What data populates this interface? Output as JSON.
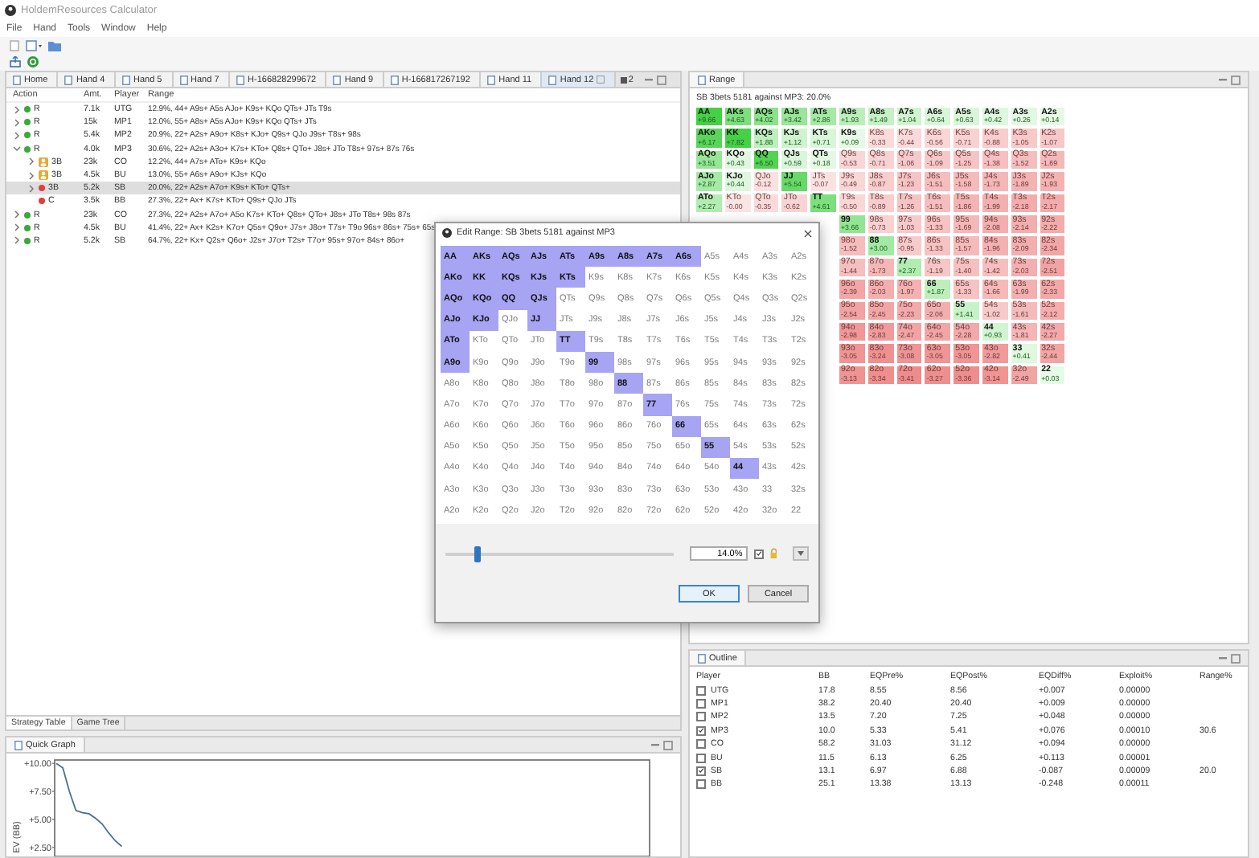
{
  "window": {
    "title": "HoldemResources Calculator"
  },
  "menu": [
    "File",
    "Hand",
    "Tools",
    "Window",
    "Help"
  ],
  "tabs": [
    {
      "label": "Home",
      "selected": false
    },
    {
      "label": "Hand 4",
      "selected": false
    },
    {
      "label": "Hand 5",
      "selected": false
    },
    {
      "label": "Hand 7",
      "selected": false
    },
    {
      "label": "H-166828299672",
      "selected": false
    },
    {
      "label": "Hand 9",
      "selected": false
    },
    {
      "label": "H-166817267192",
      "selected": false
    },
    {
      "label": "Hand 11",
      "selected": false
    },
    {
      "label": "Hand 12",
      "selected": true
    }
  ],
  "tabs_overflow": "2",
  "action_table": {
    "columns": [
      "Action",
      "Amt.",
      "Player",
      "Range"
    ],
    "rows": [
      {
        "action": "R",
        "amount": "7.1k",
        "player": "UTG",
        "range": "12.9%, 44+ A9s+ A5s AJo+ K9s+ KQo QTs+ JTs T9s",
        "kind": "dot",
        "color": "#3ba83b",
        "expanded": false,
        "selected": false
      },
      {
        "action": "R",
        "amount": "15k",
        "player": "MP1",
        "range": "12.0%, 55+ A8s+ A5s AJo+ K9s+ KQo QTs+ JTs",
        "kind": "dot",
        "color": "#3ba83b",
        "expanded": false,
        "selected": false
      },
      {
        "action": "R",
        "amount": "5.4k",
        "player": "MP2",
        "range": "20.9%, 22+ A2s+ A9o+ K8s+ KJo+ Q9s+ QJo J9s+ T8s+ 98s",
        "kind": "dot",
        "color": "#3ba83b",
        "expanded": false,
        "selected": false
      },
      {
        "action": "R",
        "amount": "4.0k",
        "player": "MP3",
        "range": "30.6%, 22+ A2s+ A3o+ K7s+ KTo+ Q8s+ QTo+ J8s+ JTo T8s+ 97s+ 87s 76s",
        "kind": "dot",
        "color": "#3ba83b",
        "expanded": true,
        "selected": false,
        "children": [
          {
            "action": "3B",
            "amount": "23k",
            "player": "CO",
            "range": "12.2%, 44+ A7s+ ATo+ K9s+ KQo",
            "kind": "player",
            "color": "#e3a93a",
            "expanded": false,
            "selected": false
          },
          {
            "action": "3B",
            "amount": "4.5k",
            "player": "BU",
            "range": "13.0%, 55+ A6s+ A9o+ KJs+ KQo",
            "kind": "player",
            "color": "#e3a93a",
            "expanded": false,
            "selected": false
          },
          {
            "action": "3B",
            "amount": "5.2k",
            "player": "SB",
            "range": "20.0%, 22+ A2s+ A7o+ K9s+ KTo+ QTs+",
            "kind": "dot",
            "color": "#d9423f",
            "expanded": false,
            "selected": true
          },
          {
            "action": "C",
            "amount": "3.5k",
            "player": "BB",
            "range": "27.3%, 22+ Ax+ K7s+ KTo+ Q9s+ QJo JTs",
            "kind": "dot",
            "color": "#d9423f",
            "selected": false
          }
        ]
      },
      {
        "action": "R",
        "amount": "23k",
        "player": "CO",
        "range": "27.3%, 22+ A2s+ A7o+ A5o K7s+ KTo+ Q8s+ QTo+ J8s+ JTo T8s+ 98s 87s",
        "kind": "dot",
        "color": "#3ba83b",
        "expanded": false,
        "selected": false
      },
      {
        "action": "R",
        "amount": "4.5k",
        "player": "BU",
        "range": "41.4%, 22+ Ax+ K2s+ K7o+ Q5s+ Q9o+ J7s+ J8o+ T7s+ T9o 96s+ 86s+ 75s+ 65s",
        "kind": "dot",
        "color": "#3ba83b",
        "expanded": false,
        "selected": false
      },
      {
        "action": "R",
        "amount": "5.2k",
        "player": "SB",
        "range": "64.7%, 22+ Kx+ Q2s+ Q6o+ J2s+ J7o+ T2s+ T7o+ 95s+ 97o+ 84s+ 86o+",
        "kind": "dot",
        "color": "#3ba83b",
        "expanded": false,
        "selected": false
      }
    ]
  },
  "bottom_tabs": [
    {
      "label": "Strategy Table",
      "selected": true
    },
    {
      "label": "Game Tree",
      "selected": false
    }
  ],
  "quick_graph": {
    "title": "Quick Graph",
    "chart_data": {
      "type": "line",
      "ylabel": "EV (BB)",
      "categories": [
        null,
        null,
        null,
        null,
        null,
        null,
        null,
        null,
        null,
        null,
        null
      ],
      "ylim": [
        1.7,
        10.3
      ],
      "yticks": [
        {
          "value": 10,
          "label": "+10.00"
        },
        {
          "value": 7.5,
          "label": "+7.50"
        },
        {
          "value": 5,
          "label": "+5.00"
        },
        {
          "value": 2.5,
          "label": "+2.50"
        }
      ],
      "series": [
        {
          "color": "#4a6f90",
          "values": [
            10,
            9.6,
            7.5,
            5.8,
            5.6,
            5.5,
            5.1,
            4.6,
            3.8,
            3.1,
            2.6
          ]
        }
      ]
    }
  },
  "range_panel": {
    "title": "Range",
    "heading": "SB 3bets 5181 against MP3: 20.0%",
    "rows": [
      [
        {
          "label": "AA",
          "ev": "+9.66"
        },
        {
          "label": "AKs",
          "ev": "+4.63"
        },
        {
          "label": "AQs",
          "ev": "+4.02"
        },
        {
          "label": "AJs",
          "ev": "+3.42"
        },
        {
          "label": "ATs",
          "ev": "+2.86"
        },
        {
          "label": "A9s",
          "ev": "+1.93"
        },
        {
          "label": "A8s",
          "ev": "+1.49"
        },
        {
          "label": "A7s",
          "ev": "+1.04"
        },
        {
          "label": "A6s",
          "ev": "+0.64"
        },
        {
          "label": "A5s",
          "ev": "+0.63"
        },
        {
          "label": "A4s",
          "ev": "+0.42"
        },
        {
          "label": "A3s",
          "ev": "+0.26"
        },
        {
          "label": "A2s",
          "ev": "+0.14"
        }
      ],
      [
        {
          "label": "AKo",
          "ev": "+6.17"
        },
        {
          "label": "KK",
          "ev": "+7.82"
        },
        {
          "label": "KQs",
          "ev": "+1.88"
        },
        {
          "label": "KJs",
          "ev": "+1.12"
        },
        {
          "label": "KTs",
          "ev": "+0.71"
        },
        {
          "label": "K9s",
          "ev": "+0.09"
        },
        {
          "label": "K8s",
          "ev": "-0.33"
        },
        {
          "label": "K7s",
          "ev": "-0.44"
        },
        {
          "label": "K6s",
          "ev": "-0.56"
        },
        {
          "label": "K5s",
          "ev": "-0.71"
        },
        {
          "label": "K4s",
          "ev": "-0.88"
        },
        {
          "label": "K3s",
          "ev": "-1.05"
        },
        {
          "label": "K2s",
          "ev": "-1.07"
        }
      ],
      [
        {
          "label": "AQo",
          "ev": "+3.51"
        },
        {
          "label": "KQo",
          "ev": "+0.43"
        },
        {
          "label": "QQ",
          "ev": "+6.50"
        },
        {
          "label": "QJs",
          "ev": "+0.59"
        },
        {
          "label": "QTs",
          "ev": "+0.18"
        },
        {
          "label": "Q9s",
          "ev": "-0.53"
        },
        {
          "label": "Q8s",
          "ev": "-0.71"
        },
        {
          "label": "Q7s",
          "ev": "-1.06"
        },
        {
          "label": "Q6s",
          "ev": "-1.09"
        },
        {
          "label": "Q5s",
          "ev": "-1.25"
        },
        {
          "label": "Q4s",
          "ev": "-1.38"
        },
        {
          "label": "Q3s",
          "ev": "-1.52"
        },
        {
          "label": "Q2s",
          "ev": "-1.69"
        }
      ],
      [
        {
          "label": "AJo",
          "ev": "+2.87"
        },
        {
          "label": "KJo",
          "ev": "+0.44"
        },
        {
          "label": "QJo",
          "ev": "-0.12"
        },
        {
          "label": "JJ",
          "ev": "+5.54"
        },
        {
          "label": "JTs",
          "ev": "-0.07"
        },
        {
          "label": "J9s",
          "ev": "-0.49"
        },
        {
          "label": "J8s",
          "ev": "-0.87"
        },
        {
          "label": "J7s",
          "ev": "-1.23"
        },
        {
          "label": "J6s",
          "ev": "-1.51"
        },
        {
          "label": "J5s",
          "ev": "-1.58"
        },
        {
          "label": "J4s",
          "ev": "-1.73"
        },
        {
          "label": "J3s",
          "ev": "-1.89"
        },
        {
          "label": "J2s",
          "ev": "-1.93"
        }
      ],
      [
        {
          "label": "ATo",
          "ev": "+2.27"
        },
        {
          "label": "KTo",
          "ev": "-0.00"
        },
        {
          "label": "QTo",
          "ev": "-0.35"
        },
        {
          "label": "JTo",
          "ev": "-0.62"
        },
        {
          "label": "TT",
          "ev": "+4.61"
        },
        {
          "label": "T9s",
          "ev": "-0.50"
        },
        {
          "label": "T8s",
          "ev": "-0.89"
        },
        {
          "label": "T7s",
          "ev": "-1.26"
        },
        {
          "label": "T6s",
          "ev": "-1.51"
        },
        {
          "label": "T5s",
          "ev": "-1.86"
        },
        {
          "label": "T4s",
          "ev": "-1.99"
        },
        {
          "label": "T3s",
          "ev": "-2.18"
        },
        {
          "label": "T2s",
          "ev": "-2.17"
        }
      ],
      [
        {
          "label": "99",
          "ev": "+3.66"
        },
        {
          "label": "98s",
          "ev": "-0.73"
        },
        {
          "label": "97s",
          "ev": "-1.03"
        },
        {
          "label": "96s",
          "ev": "-1.33"
        },
        {
          "label": "95s",
          "ev": "-1.69"
        },
        {
          "label": "94s",
          "ev": "-2.08"
        },
        {
          "label": "93s",
          "ev": "-2.14"
        },
        {
          "label": "92s",
          "ev": "-2.22"
        }
      ],
      [
        {
          "label": "98o",
          "ev": "-1.52"
        },
        {
          "label": "88",
          "ev": "+3.00"
        },
        {
          "label": "87s",
          "ev": "-0.95"
        },
        {
          "label": "86s",
          "ev": "-1.33"
        },
        {
          "label": "85s",
          "ev": "-1.57"
        },
        {
          "label": "84s",
          "ev": "-1.96"
        },
        {
          "label": "83s",
          "ev": "-2.09"
        },
        {
          "label": "82s",
          "ev": "-2.34"
        }
      ],
      [
        {
          "label": "97o",
          "ev": "-1.44"
        },
        {
          "label": "87o",
          "ev": "-1.73"
        },
        {
          "label": "77",
          "ev": "+2.37"
        },
        {
          "label": "76s",
          "ev": "-1.19"
        },
        {
          "label": "75s",
          "ev": "-1.40"
        },
        {
          "label": "74s",
          "ev": "-1.42"
        },
        {
          "label": "73s",
          "ev": "-2.03"
        },
        {
          "label": "72s",
          "ev": "-2.51"
        }
      ],
      [
        {
          "label": "96o",
          "ev": "-2.39"
        },
        {
          "label": "86o",
          "ev": "-2.03"
        },
        {
          "label": "76o",
          "ev": "-1.97"
        },
        {
          "label": "66",
          "ev": "+1.87"
        },
        {
          "label": "65s",
          "ev": "-1.33"
        },
        {
          "label": "64s",
          "ev": "-1.66"
        },
        {
          "label": "63s",
          "ev": "-1.99"
        },
        {
          "label": "62s",
          "ev": "-2.33"
        }
      ],
      [
        {
          "label": "95o",
          "ev": "-2.54"
        },
        {
          "label": "85o",
          "ev": "-2.45"
        },
        {
          "label": "75o",
          "ev": "-2.23"
        },
        {
          "label": "65o",
          "ev": "-2.06"
        },
        {
          "label": "55",
          "ev": "+1.41"
        },
        {
          "label": "54s",
          "ev": "-1.02"
        },
        {
          "label": "53s",
          "ev": "-1.61"
        },
        {
          "label": "52s",
          "ev": "-2.12"
        }
      ],
      [
        {
          "label": "94o",
          "ev": "-2.98"
        },
        {
          "label": "84o",
          "ev": "-2.83"
        },
        {
          "label": "74o",
          "ev": "-2.47"
        },
        {
          "label": "64o",
          "ev": "-2.45"
        },
        {
          "label": "54o",
          "ev": "-2.28"
        },
        {
          "label": "44",
          "ev": "+0.93"
        },
        {
          "label": "43s",
          "ev": "-1.81"
        },
        {
          "label": "42s",
          "ev": "-2.27"
        }
      ],
      [
        {
          "label": "93o",
          "ev": "-3.05"
        },
        {
          "label": "83o",
          "ev": "-3.24"
        },
        {
          "label": "73o",
          "ev": "-3.08"
        },
        {
          "label": "63o",
          "ev": "-3.05"
        },
        {
          "label": "53o",
          "ev": "-3.05"
        },
        {
          "label": "43o",
          "ev": "-2.82"
        },
        {
          "label": "33",
          "ev": "+0.41"
        },
        {
          "label": "32s",
          "ev": "-2.44"
        }
      ],
      [
        {
          "label": "92o",
          "ev": "-3.13"
        },
        {
          "label": "82o",
          "ev": "-3.34"
        },
        {
          "label": "72o",
          "ev": "-3.41"
        },
        {
          "label": "62o",
          "ev": "-3.27"
        },
        {
          "label": "52o",
          "ev": "-3.36"
        },
        {
          "label": "42o",
          "ev": "-3.14"
        },
        {
          "label": "32o",
          "ev": "-2.49"
        },
        {
          "label": "22",
          "ev": "+0.03"
        }
      ]
    ]
  },
  "outline": {
    "title": "Outline",
    "columns": [
      "Player",
      "BB",
      "EQPre%",
      "EQPost%",
      "EQDiff%",
      "Exploit%",
      "Range%"
    ],
    "rows": [
      {
        "checked": false,
        "player": "UTG",
        "bb": "17.8",
        "eq_pre": "8.55",
        "eq_post": "8.56",
        "eq_diff": "+0.007",
        "exploit": "0.00000"
      },
      {
        "checked": false,
        "player": "MP1",
        "bb": "38.2",
        "eq_pre": "20.40",
        "eq_post": "20.40",
        "eq_diff": "+0.009",
        "exploit": "0.00000"
      },
      {
        "checked": false,
        "player": "MP2",
        "bb": "13.5",
        "eq_pre": "7.20",
        "eq_post": "7.25",
        "eq_diff": "+0.048",
        "exploit": "0.00000"
      },
      {
        "checked": true,
        "player": "MP3",
        "bb": "10.0",
        "eq_pre": "5.33",
        "eq_post": "5.41",
        "eq_diff": "+0.076",
        "exploit": "0.00010",
        "range": "30.6"
      },
      {
        "checked": false,
        "player": "CO",
        "bb": "58.2",
        "eq_pre": "31.03",
        "eq_post": "31.12",
        "eq_diff": "+0.094",
        "exploit": "0.00000"
      },
      {
        "checked": false,
        "player": "BU",
        "bb": "11.5",
        "eq_pre": "6.13",
        "eq_post": "6.25",
        "eq_diff": "+0.113",
        "exploit": "0.00001"
      },
      {
        "checked": true,
        "player": "SB",
        "bb": "13.1",
        "eq_pre": "6.97",
        "eq_post": "6.88",
        "eq_diff": "-0.087",
        "exploit": "0.00009",
        "range": "20.0"
      },
      {
        "checked": false,
        "player": "BB",
        "bb": "25.1",
        "eq_pre": "13.38",
        "eq_post": "13.13",
        "eq_diff": "-0.248",
        "exploit": "0.00011"
      }
    ]
  },
  "dialog": {
    "title": "Edit Range: SB 3bets 5181 against MP3",
    "slider": {
      "level": 0.14
    },
    "percent": "14.0%",
    "lock_checked": true,
    "ok": "OK",
    "cancel": "Cancel",
    "rows": [
      [
        {
          "label": "AA",
          "selected": true
        },
        {
          "label": "AKs",
          "selected": true
        },
        {
          "label": "AQs",
          "selected": true
        },
        {
          "label": "AJs",
          "selected": true
        },
        {
          "label": "ATs",
          "selected": true
        },
        {
          "label": "A9s",
          "selected": true
        },
        {
          "label": "A8s",
          "selected": true
        },
        {
          "label": "A7s",
          "selected": true
        },
        {
          "label": "A6s",
          "selected": true
        },
        {
          "label": "A5s",
          "selected": false
        },
        {
          "label": "A4s",
          "selected": false
        },
        {
          "label": "A3s",
          "selected": false
        },
        {
          "label": "A2s",
          "selected": false
        }
      ],
      [
        {
          "label": "AKo",
          "selected": true
        },
        {
          "label": "KK",
          "selected": true
        },
        {
          "label": "KQs",
          "selected": true
        },
        {
          "label": "KJs",
          "selected": true
        },
        {
          "label": "KTs",
          "selected": true
        },
        {
          "label": "K9s",
          "selected": false
        },
        {
          "label": "K8s",
          "selected": false
        },
        {
          "label": "K7s",
          "selected": false
        },
        {
          "label": "K6s",
          "selected": false
        },
        {
          "label": "K5s",
          "selected": false
        },
        {
          "label": "K4s",
          "selected": false
        },
        {
          "label": "K3s",
          "selected": false
        },
        {
          "label": "K2s",
          "selected": false
        }
      ],
      [
        {
          "label": "AQo",
          "selected": true
        },
        {
          "label": "KQo",
          "selected": true
        },
        {
          "label": "QQ",
          "selected": true
        },
        {
          "label": "QJs",
          "selected": true
        },
        {
          "label": "QTs",
          "selected": false
        },
        {
          "label": "Q9s",
          "selected": false
        },
        {
          "label": "Q8s",
          "selected": false
        },
        {
          "label": "Q7s",
          "selected": false
        },
        {
          "label": "Q6s",
          "selected": false
        },
        {
          "label": "Q5s",
          "selected": false
        },
        {
          "label": "Q4s",
          "selected": false
        },
        {
          "label": "Q3s",
          "selected": false
        },
        {
          "label": "Q2s",
          "selected": false
        }
      ],
      [
        {
          "label": "AJo",
          "selected": true
        },
        {
          "label": "KJo",
          "selected": true
        },
        {
          "label": "QJo",
          "selected": false
        },
        {
          "label": "JJ",
          "selected": true
        },
        {
          "label": "JTs",
          "selected": false
        },
        {
          "label": "J9s",
          "selected": false
        },
        {
          "label": "J8s",
          "selected": false
        },
        {
          "label": "J7s",
          "selected": false
        },
        {
          "label": "J6s",
          "selected": false
        },
        {
          "label": "J5s",
          "selected": false
        },
        {
          "label": "J4s",
          "selected": false
        },
        {
          "label": "J3s",
          "selected": false
        },
        {
          "label": "J2s",
          "selected": false
        }
      ],
      [
        {
          "label": "ATo",
          "selected": true
        },
        {
          "label": "KTo",
          "selected": false
        },
        {
          "label": "QTo",
          "selected": false
        },
        {
          "label": "JTo",
          "selected": false
        },
        {
          "label": "TT",
          "selected": true
        },
        {
          "label": "T9s",
          "selected": false
        },
        {
          "label": "T8s",
          "selected": false
        },
        {
          "label": "T7s",
          "selected": false
        },
        {
          "label": "T6s",
          "selected": false
        },
        {
          "label": "T5s",
          "selected": false
        },
        {
          "label": "T4s",
          "selected": false
        },
        {
          "label": "T3s",
          "selected": false
        },
        {
          "label": "T2s",
          "selected": false
        }
      ],
      [
        {
          "label": "A9o",
          "selected": true
        },
        {
          "label": "K9o",
          "selected": false
        },
        {
          "label": "Q9o",
          "selected": false
        },
        {
          "label": "J9o",
          "selected": false
        },
        {
          "label": "T9o",
          "selected": false
        },
        {
          "label": "99",
          "selected": true
        },
        {
          "label": "98s",
          "selected": false
        },
        {
          "label": "97s",
          "selected": false
        },
        {
          "label": "96s",
          "selected": false
        },
        {
          "label": "95s",
          "selected": false
        },
        {
          "label": "94s",
          "selected": false
        },
        {
          "label": "93s",
          "selected": false
        },
        {
          "label": "92s",
          "selected": false
        }
      ],
      [
        {
          "label": "A8o",
          "selected": false
        },
        {
          "label": "K8o",
          "selected": false
        },
        {
          "label": "Q8o",
          "selected": false
        },
        {
          "label": "J8o",
          "selected": false
        },
        {
          "label": "T8o",
          "selected": false
        },
        {
          "label": "98o",
          "selected": false
        },
        {
          "label": "88",
          "selected": true
        },
        {
          "label": "87s",
          "selected": false
        },
        {
          "label": "86s",
          "selected": false
        },
        {
          "label": "85s",
          "selected": false
        },
        {
          "label": "84s",
          "selected": false
        },
        {
          "label": "83s",
          "selected": false
        },
        {
          "label": "82s",
          "selected": false
        }
      ],
      [
        {
          "label": "A7o",
          "selected": false
        },
        {
          "label": "K7o",
          "selected": false
        },
        {
          "label": "Q7o",
          "selected": false
        },
        {
          "label": "J7o",
          "selected": false
        },
        {
          "label": "T7o",
          "selected": false
        },
        {
          "label": "97o",
          "selected": false
        },
        {
          "label": "87o",
          "selected": false
        },
        {
          "label": "77",
          "selected": true
        },
        {
          "label": "76s",
          "selected": false
        },
        {
          "label": "75s",
          "selected": false
        },
        {
          "label": "74s",
          "selected": false
        },
        {
          "label": "73s",
          "selected": false
        },
        {
          "label": "72s",
          "selected": false
        }
      ],
      [
        {
          "label": "A6o",
          "selected": false
        },
        {
          "label": "K6o",
          "selected": false
        },
        {
          "label": "Q6o",
          "selected": false
        },
        {
          "label": "J6o",
          "selected": false
        },
        {
          "label": "T6o",
          "selected": false
        },
        {
          "label": "96o",
          "selected": false
        },
        {
          "label": "86o",
          "selected": false
        },
        {
          "label": "76o",
          "selected": false
        },
        {
          "label": "66",
          "selected": true
        },
        {
          "label": "65s",
          "selected": false
        },
        {
          "label": "64s",
          "selected": false
        },
        {
          "label": "63s",
          "selected": false
        },
        {
          "label": "62s",
          "selected": false
        }
      ],
      [
        {
          "label": "A5o",
          "selected": false
        },
        {
          "label": "K5o",
          "selected": false
        },
        {
          "label": "Q5o",
          "selected": false
        },
        {
          "label": "J5o",
          "selected": false
        },
        {
          "label": "T5o",
          "selected": false
        },
        {
          "label": "95o",
          "selected": false
        },
        {
          "label": "85o",
          "selected": false
        },
        {
          "label": "75o",
          "selected": false
        },
        {
          "label": "65o",
          "selected": false
        },
        {
          "label": "55",
          "selected": true
        },
        {
          "label": "54s",
          "selected": false
        },
        {
          "label": "53s",
          "selected": false
        },
        {
          "label": "52s",
          "selected": false
        }
      ],
      [
        {
          "label": "A4o",
          "selected": false
        },
        {
          "label": "K4o",
          "selected": false
        },
        {
          "label": "Q4o",
          "selected": false
        },
        {
          "label": "J4o",
          "selected": false
        },
        {
          "label": "T4o",
          "selected": false
        },
        {
          "label": "94o",
          "selected": false
        },
        {
          "label": "84o",
          "selected": false
        },
        {
          "label": "74o",
          "selected": false
        },
        {
          "label": "64o",
          "selected": false
        },
        {
          "label": "54o",
          "selected": false
        },
        {
          "label": "44",
          "selected": true
        },
        {
          "label": "43s",
          "selected": false
        },
        {
          "label": "42s",
          "selected": false
        }
      ],
      [
        {
          "label": "A3o",
          "selected": false
        },
        {
          "label": "K3o",
          "selected": false
        },
        {
          "label": "Q3o",
          "selected": false
        },
        {
          "label": "J3o",
          "selected": false
        },
        {
          "label": "T3o",
          "selected": false
        },
        {
          "label": "93o",
          "selected": false
        },
        {
          "label": "83o",
          "selected": false
        },
        {
          "label": "73o",
          "selected": false
        },
        {
          "label": "63o",
          "selected": false
        },
        {
          "label": "53o",
          "selected": false
        },
        {
          "label": "43o",
          "selected": false
        },
        {
          "label": "33",
          "selected": false
        },
        {
          "label": "32s",
          "selected": false
        }
      ],
      [
        {
          "label": "A2o",
          "selected": false
        },
        {
          "label": "K2o",
          "selected": false
        },
        {
          "label": "Q2o",
          "selected": false
        },
        {
          "label": "J2o",
          "selected": false
        },
        {
          "label": "T2o",
          "selected": false
        },
        {
          "label": "92o",
          "selected": false
        },
        {
          "label": "82o",
          "selected": false
        },
        {
          "label": "72o",
          "selected": false
        },
        {
          "label": "62o",
          "selected": false
        },
        {
          "label": "52o",
          "selected": false
        },
        {
          "label": "42o",
          "selected": false
        },
        {
          "label": "32o",
          "selected": false
        },
        {
          "label": "22",
          "selected": false
        }
      ]
    ]
  }
}
